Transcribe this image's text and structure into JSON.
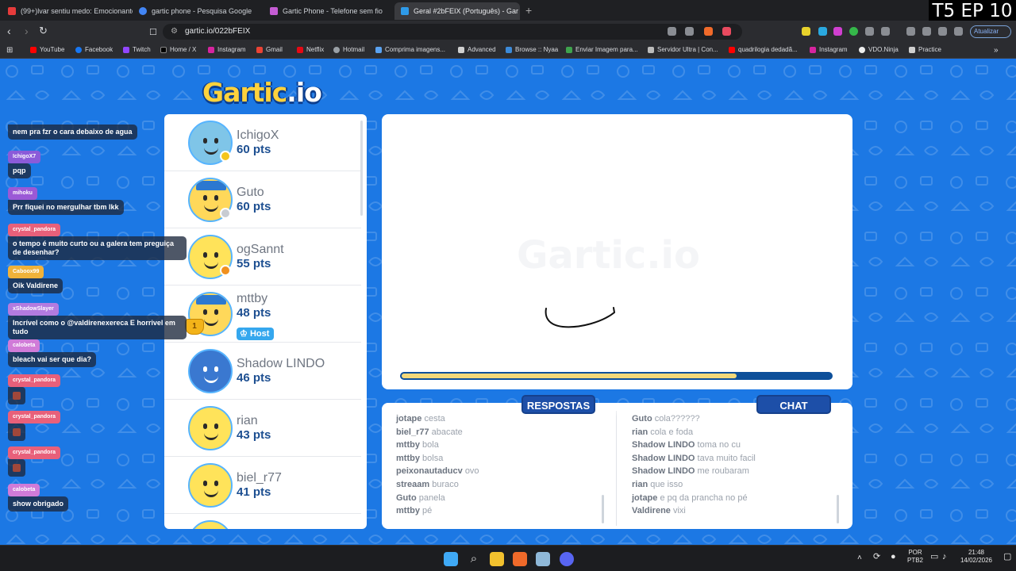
{
  "browser": {
    "tabs": [
      {
        "label": "(99+)lvar sentiu medo: Emocionante",
        "color": "#e63b3b"
      },
      {
        "label": "gartic phone - Pesquisa Google",
        "color": "#4285f4"
      },
      {
        "label": "Gartic Phone - Telefone sem fio",
        "color": "#c45cd3"
      },
      {
        "label": "Geral #2bFEIX (Português) - Gar",
        "color": "#2e9ae8",
        "active": true
      }
    ],
    "new_tab": "+",
    "url": "gartic.io/022bFEIX",
    "update_button": "Atualizar",
    "bookmarks": [
      "YouTube",
      "Facebook",
      "Twitch",
      "Home / X",
      "Instagram",
      "Gmail",
      "Netflix",
      "Hotmail",
      "Comprima imagens...",
      "Advanced",
      "Browse :: Nyaa",
      "Enviar Imagem para...",
      "Servidor Ultra | Con...",
      "quadrilogia dedadã...",
      "Instagram",
      "VDO.Ninja",
      "Practice"
    ]
  },
  "episode_tag": "T5 EP 10",
  "game": {
    "logo_main": "Gartic",
    "logo_suffix": ".io",
    "players": [
      {
        "name": "IchigoX",
        "pts": "60 pts",
        "status_color": "#f4c51c",
        "avatar": "blue"
      },
      {
        "name": "Guto",
        "pts": "60 pts",
        "status_color": "#c8ccd2",
        "avatar": "hat"
      },
      {
        "name": "ogSannt",
        "pts": "55 pts",
        "status_color": "#f0901e",
        "avatar": "plain"
      },
      {
        "name": "mttby",
        "pts": "48 pts",
        "host": "Host",
        "rank": "1",
        "avatar": "hat"
      },
      {
        "name": "Shadow LINDO",
        "pts": "46 pts",
        "avatar": "bluebeard"
      },
      {
        "name": "rian",
        "pts": "43 pts",
        "avatar": "plain"
      },
      {
        "name": "biel_r77",
        "pts": "41 pts",
        "avatar": "plain"
      }
    ],
    "canvas_watermark": "Gartic.io",
    "timer_remaining": 0.78,
    "answers_title": "RESPOSTAS",
    "chat_title": "CHAT",
    "answers": [
      {
        "user": "jotape",
        "msg": "cesta"
      },
      {
        "user": "biel_r77",
        "msg": "abacate"
      },
      {
        "user": "mttby",
        "msg": "bola"
      },
      {
        "user": "mttby",
        "msg": "bolsa"
      },
      {
        "user": "peixonautaducv",
        "msg": "ovo"
      },
      {
        "user": "streaam",
        "msg": "buraco"
      },
      {
        "user": "Guto",
        "msg": "panela"
      },
      {
        "user": "mttby",
        "msg": "pé"
      }
    ],
    "chat": [
      {
        "user": "Guto",
        "msg": "cola??????"
      },
      {
        "user": "rian",
        "msg": "cola e foda"
      },
      {
        "user": "Shadow LINDO",
        "msg": "toma no cu"
      },
      {
        "user": "Shadow LINDO",
        "msg": "tava muito facil"
      },
      {
        "user": "Shadow LINDO",
        "msg": "me roubaram"
      },
      {
        "user": "rian",
        "msg": "que isso"
      },
      {
        "user": "jotape",
        "msg": "e pq da prancha no pé"
      },
      {
        "user": "Valdirene",
        "msg": "vixi"
      }
    ]
  },
  "overlay_chat": [
    {
      "user": "",
      "msg": "nem pra fzr o cara debaixo de agua",
      "color": "#7b8fc9"
    },
    {
      "user": "IchigoX7",
      "msg": "pqp",
      "color": "#8b5bd9"
    },
    {
      "user": "mihoku",
      "msg": "Prr fiquei no mergulhar tbm lkk",
      "color": "#9b59d6"
    },
    {
      "user": "crystal_pandora",
      "msg": "o tempo é muito curto ou a galera tem preguiça de desenhar?",
      "color": "#e8607a"
    },
    {
      "user": "Caboox99",
      "msg": "Oik Valdirene",
      "color": "#f0b23a"
    },
    {
      "user": "xShadowSlayer",
      "msg": "Incrível como o @valdirenexereca E horrivel em tudo",
      "color": "#b37be0"
    },
    {
      "user": "calobeta",
      "msg": "bleach vai ser que dia?",
      "color": "#d07bd8"
    },
    {
      "user": "crystal_pandora",
      "msg": "",
      "color": "#e8607a"
    },
    {
      "user": "crystal_pandora",
      "msg": "",
      "color": "#e8607a"
    },
    {
      "user": "crystal_pandora",
      "msg": "",
      "color": "#e8607a"
    },
    {
      "user": "calobeta",
      "msg": "show obrigado",
      "color": "#d07bd8"
    }
  ],
  "taskbar": {
    "lang": "POR",
    "layout": "PTB2",
    "time": "21:48",
    "date": "14/02/2026"
  }
}
